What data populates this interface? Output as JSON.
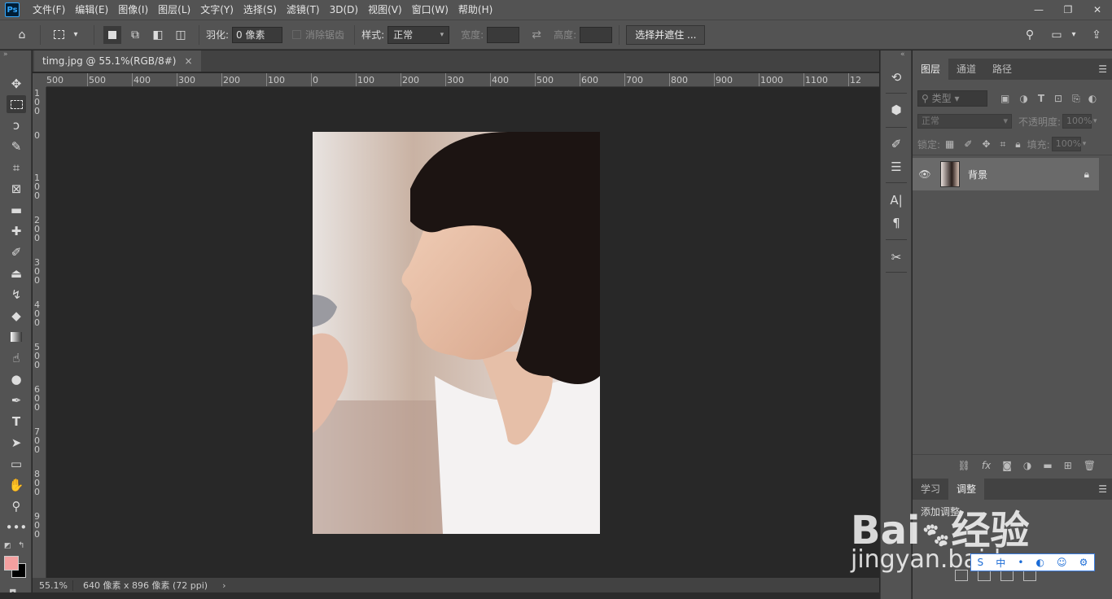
{
  "app": {
    "logo": "Ps"
  },
  "menu": [
    "文件(F)",
    "编辑(E)",
    "图像(I)",
    "图层(L)",
    "文字(Y)",
    "选择(S)",
    "滤镜(T)",
    "3D(D)",
    "视图(V)",
    "窗口(W)",
    "帮助(H)"
  ],
  "window_controls": {
    "minimize": "—",
    "restore": "❐",
    "close": "✕"
  },
  "options": {
    "feather_label": "羽化:",
    "feather_value": "0 像素",
    "antialias_label": "消除锯齿",
    "style_label": "样式:",
    "style_value": "正常",
    "width_label": "宽度:",
    "height_label": "高度:",
    "select_mask_button": "选择并遮住 ..."
  },
  "document": {
    "tab_title": "timg.jpg @ 55.1%(RGB/8#)",
    "close": "×"
  },
  "ruler": {
    "h_ticks": [
      "500",
      "500",
      "400",
      "300",
      "200",
      "100",
      "0",
      "100",
      "200",
      "300",
      "400",
      "500",
      "600",
      "700",
      "800",
      "900",
      "1000",
      "1100",
      "12"
    ],
    "v_ticks": [
      "100",
      "0",
      "100",
      "200",
      "300",
      "400",
      "500",
      "600",
      "700",
      "800",
      "900"
    ]
  },
  "status": {
    "zoom": "55.1%",
    "info": "640 像素 x 896 像素 (72 ppi)",
    "arrow": "›"
  },
  "layers_panel": {
    "tabs": [
      "图层",
      "通道",
      "路径"
    ],
    "search_placeholder": "类型",
    "blend_mode": "正常",
    "opacity_label": "不透明度:",
    "opacity_value": "100%",
    "lock_label": "锁定:",
    "fill_label": "填充:",
    "fill_value": "100%",
    "layer_name": "背景"
  },
  "adjust_panel": {
    "tabs": [
      "学习",
      "调整"
    ],
    "add_label": "添加调整"
  },
  "watermark": {
    "logo": "Bai",
    "logo_suffix": "经验",
    "url": "jingyan.baidu.com"
  },
  "ime": [
    "S",
    "中",
    "•",
    "◐",
    "☺",
    "⚙"
  ],
  "colors": {
    "foreground": "#f4a0a0",
    "background": "#000000",
    "accent": "#31a8ff"
  }
}
